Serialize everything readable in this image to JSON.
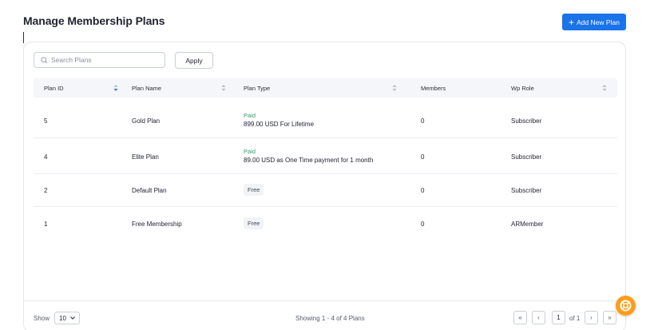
{
  "header": {
    "title": "Manage Membership Plans",
    "add_button_plus": "+",
    "add_button_label": "Add New Plan"
  },
  "toolbar": {
    "search_placeholder": "Search Plans",
    "apply_label": "Apply"
  },
  "table": {
    "columns": [
      "Plan ID",
      "Plan Name",
      "Plan Type",
      "Members",
      "Wp Role"
    ],
    "rows": [
      {
        "id": "5",
        "name": "Gold Plan",
        "type_label": "Paid",
        "type_detail": "899.00 USD For Lifetime",
        "members": "0",
        "role": "Subscriber"
      },
      {
        "id": "4",
        "name": "Elite Plan",
        "type_label": "Paid",
        "type_detail": "89.00 USD as One Time payment for 1 month",
        "members": "0",
        "role": "Subscriber"
      },
      {
        "id": "2",
        "name": "Default Plan",
        "type_label": "Free",
        "type_detail": "",
        "members": "0",
        "role": "Subscriber"
      },
      {
        "id": "1",
        "name": "Free Membership",
        "type_label": "Free",
        "type_detail": "",
        "members": "0",
        "role": "ARMember"
      }
    ]
  },
  "footer": {
    "show_label": "Show",
    "page_size": "10",
    "showing_text": "Showing 1 - 4 of 4 Plans",
    "first_label": "«",
    "prev_label": "‹",
    "current_page": "1",
    "of_text": "of 1",
    "next_label": "›",
    "last_label": "»"
  },
  "colors": {
    "accent": "#1a73e8",
    "paid": "#2e9e63",
    "help_fab": "#ff9d1a"
  },
  "icons": {
    "search": "search-icon",
    "sort": "sort-icon",
    "chevron": "chevron-down-icon",
    "help": "lifebuoy-icon"
  }
}
